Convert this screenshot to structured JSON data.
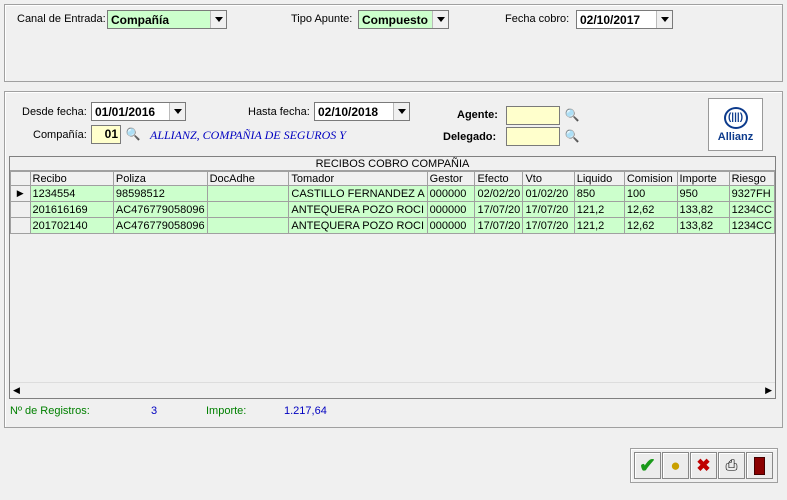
{
  "top": {
    "canal_label": "Canal de Entrada:",
    "canal_value": "Compañía",
    "tipo_label": "Tipo Apunte:",
    "tipo_value": "Compuesto",
    "fecha_cobro_label": "Fecha cobro:",
    "fecha_cobro_value": "02/10/2017"
  },
  "filters": {
    "desde_label": "Desde fecha:",
    "desde_value": "01/01/2016",
    "hasta_label": "Hasta fecha:",
    "hasta_value": "02/10/2018",
    "compania_label": "Compañía:",
    "compania_code": "01",
    "compania_name": "ALLIANZ, COMPAÑIA DE SEGUROS Y",
    "agente_label": "Agente:",
    "agente_value": "",
    "delegado_label": "Delegado:",
    "delegado_value": "",
    "logo_text": "Allianz",
    "logo_mark": "(|||)"
  },
  "grid": {
    "title": "RECIBOS COBRO COMPAÑIA",
    "columns": [
      "Recibo",
      "Poliza",
      "DocAdhe",
      "Tomador",
      "Gestor",
      "Efecto",
      "Vto",
      "Liquido",
      "Comision",
      "Importe",
      "Riesgo"
    ],
    "rows": [
      [
        "1234554",
        "98598512",
        "",
        "CASTILLO FERNANDEZ A",
        "000000",
        "02/02/20",
        "01/02/20",
        "850",
        "100",
        "950",
        "9327FH"
      ],
      [
        "201616169",
        "AC476779058096",
        "",
        "ANTEQUERA POZO ROCI",
        "000000",
        "17/07/20",
        "17/07/20",
        "121,2",
        "12,62",
        "133,82",
        "1234CC"
      ],
      [
        "201702140",
        "AC476779058096",
        "",
        "ANTEQUERA POZO ROCI",
        "000000",
        "17/07/20",
        "17/07/20",
        "121,2",
        "12,62",
        "133,82",
        "1234CC"
      ]
    ]
  },
  "summary": {
    "registros_label": "Nº de Registros:",
    "registros_value": "3",
    "importe_label": "Importe:",
    "importe_value": "1.217,64"
  },
  "colors": {
    "green_field": "#ccffcc",
    "yellow_field": "#ffffcc",
    "blue_text": "#0000c0",
    "summary_label": "#008000"
  }
}
